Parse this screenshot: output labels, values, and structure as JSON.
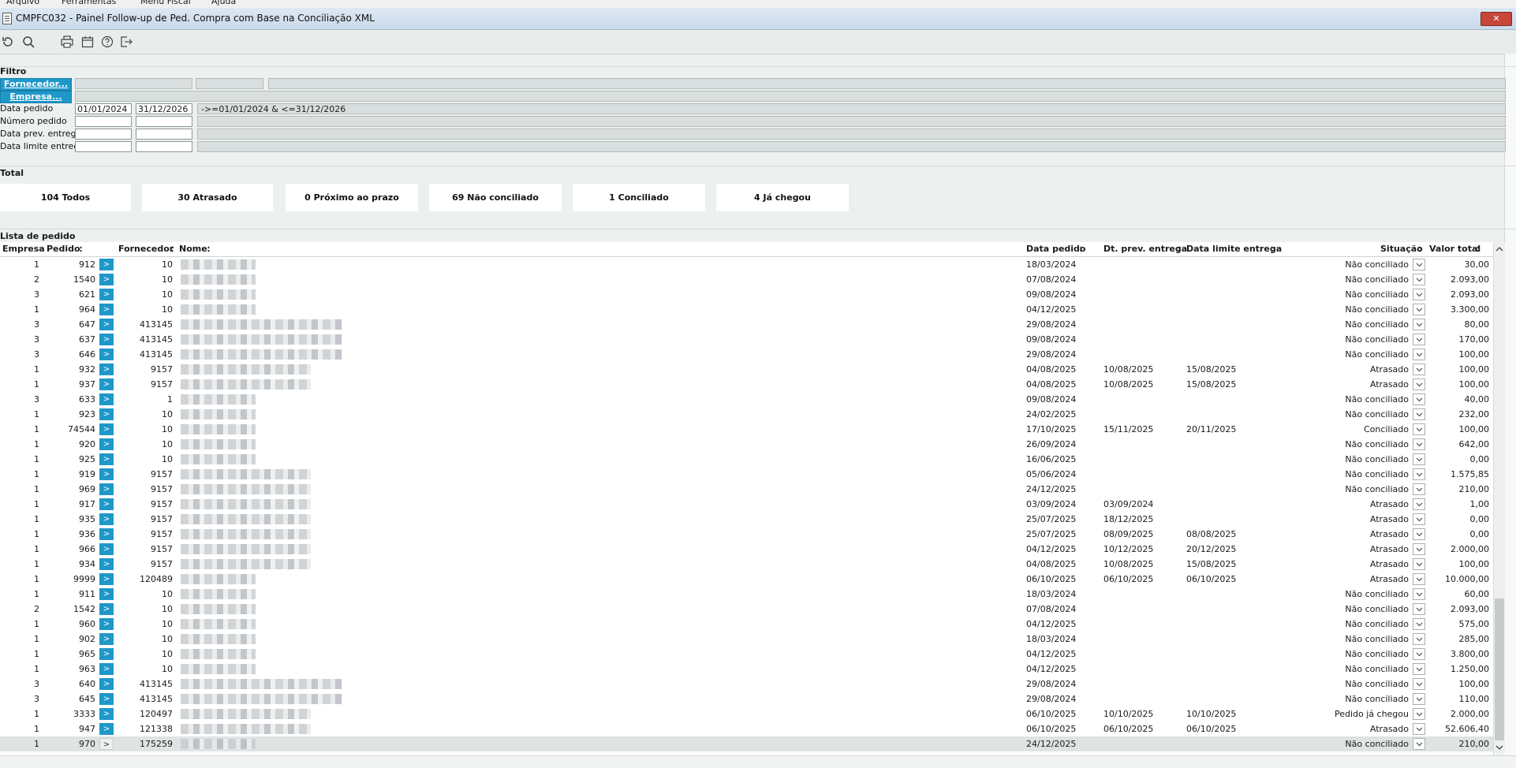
{
  "menu": [
    "Arquivo",
    "Ferramentas",
    "Menu Fiscal",
    "Ajuda"
  ],
  "window": {
    "title": "CMPFC032 - Painel Follow-up de Ped. Compra com Base na Conciliação XML",
    "close_label": "✕"
  },
  "toolbar": {
    "icons": [
      "refresh-icon",
      "search-icon",
      "print-icon",
      "calendar-icon",
      "help-icon",
      "exit-icon"
    ]
  },
  "filter": {
    "title": "Filtro",
    "fornecedor_button": "Fornecedor...",
    "empresa_button": "Empresa...",
    "data_pedido_label": "Data pedido",
    "data_pedido_from": "01/01/2024",
    "data_pedido_to": "31/12/2026",
    "data_pedido_expr": "->=01/01/2024 & <=31/12/2026",
    "numero_pedido_label": "Número pedido",
    "data_prev_label": "Data prev. entrega",
    "data_limite_label": "Data limite entrega"
  },
  "totals": {
    "title": "Total",
    "boxes": [
      "104 Todos",
      "30 Atrasado",
      "0 Próximo ao prazo",
      "69 Não conciliado",
      "1 Conciliado",
      "4 Já chegou"
    ]
  },
  "list": {
    "title": "Lista de pedido",
    "columns": {
      "empresa": "Empresa",
      "pedido": "Pedido",
      "fornecedor": "Fornecedor",
      "nome": "Nome",
      "data_pedido": "Data pedido",
      "dt_prev": "Dt. prev. entrega",
      "data_limite": "Data limite entrega",
      "situacao": "Situação",
      "valor_total": "Valor total"
    },
    "go_label": ">",
    "rows": [
      [
        "1",
        "912",
        "10",
        "18/03/2024",
        "",
        "",
        "Não conciliado",
        "30,00"
      ],
      [
        "2",
        "1540",
        "10",
        "07/08/2024",
        "",
        "",
        "Não conciliado",
        "2.093,00"
      ],
      [
        "3",
        "621",
        "10",
        "09/08/2024",
        "",
        "",
        "Não conciliado",
        "2.093,00"
      ],
      [
        "1",
        "964",
        "10",
        "04/12/2025",
        "",
        "",
        "Não conciliado",
        "3.300,00"
      ],
      [
        "3",
        "647",
        "413145",
        "29/08/2024",
        "",
        "",
        "Não conciliado",
        "80,00"
      ],
      [
        "3",
        "637",
        "413145",
        "09/08/2024",
        "",
        "",
        "Não conciliado",
        "170,00"
      ],
      [
        "3",
        "646",
        "413145",
        "29/08/2024",
        "",
        "",
        "Não conciliado",
        "100,00"
      ],
      [
        "1",
        "932",
        "9157",
        "04/08/2025",
        "10/08/2025",
        "15/08/2025",
        "Atrasado",
        "100,00"
      ],
      [
        "1",
        "937",
        "9157",
        "04/08/2025",
        "10/08/2025",
        "15/08/2025",
        "Atrasado",
        "100,00"
      ],
      [
        "3",
        "633",
        "1",
        "09/08/2024",
        "",
        "",
        "Não conciliado",
        "40,00"
      ],
      [
        "1",
        "923",
        "10",
        "24/02/2025",
        "",
        "",
        "Não conciliado",
        "232,00"
      ],
      [
        "1",
        "74544",
        "10",
        "17/10/2025",
        "15/11/2025",
        "20/11/2025",
        "Conciliado",
        "100,00"
      ],
      [
        "1",
        "920",
        "10",
        "26/09/2024",
        "",
        "",
        "Não conciliado",
        "642,00"
      ],
      [
        "1",
        "925",
        "10",
        "16/06/2025",
        "",
        "",
        "Não conciliado",
        "0,00"
      ],
      [
        "1",
        "919",
        "9157",
        "05/06/2024",
        "",
        "",
        "Não conciliado",
        "1.575,85"
      ],
      [
        "1",
        "969",
        "9157",
        "24/12/2025",
        "",
        "",
        "Não conciliado",
        "210,00"
      ],
      [
        "1",
        "917",
        "9157",
        "03/09/2024",
        "03/09/2024",
        "",
        "Atrasado",
        "1,00"
      ],
      [
        "1",
        "935",
        "9157",
        "25/07/2025",
        "18/12/2025",
        "",
        "Atrasado",
        "0,00"
      ],
      [
        "1",
        "936",
        "9157",
        "25/07/2025",
        "08/09/2025",
        "08/08/2025",
        "Atrasado",
        "0,00"
      ],
      [
        "1",
        "966",
        "9157",
        "04/12/2025",
        "10/12/2025",
        "20/12/2025",
        "Atrasado",
        "2.000,00"
      ],
      [
        "1",
        "934",
        "9157",
        "04/08/2025",
        "10/08/2025",
        "15/08/2025",
        "Atrasado",
        "100,00"
      ],
      [
        "1",
        "9999",
        "120489",
        "06/10/2025",
        "06/10/2025",
        "06/10/2025",
        "Atrasado",
        "10.000,00"
      ],
      [
        "1",
        "911",
        "10",
        "18/03/2024",
        "",
        "",
        "Não conciliado",
        "60,00"
      ],
      [
        "2",
        "1542",
        "10",
        "07/08/2024",
        "",
        "",
        "Não conciliado",
        "2.093,00"
      ],
      [
        "1",
        "960",
        "10",
        "04/12/2025",
        "",
        "",
        "Não conciliado",
        "575,00"
      ],
      [
        "1",
        "902",
        "10",
        "18/03/2024",
        "",
        "",
        "Não conciliado",
        "285,00"
      ],
      [
        "1",
        "965",
        "10",
        "04/12/2025",
        "",
        "",
        "Não conciliado",
        "3.800,00"
      ],
      [
        "1",
        "963",
        "10",
        "04/12/2025",
        "",
        "",
        "Não conciliado",
        "1.250,00"
      ],
      [
        "3",
        "640",
        "413145",
        "29/08/2024",
        "",
        "",
        "Não conciliado",
        "100,00"
      ],
      [
        "3",
        "645",
        "413145",
        "29/08/2024",
        "",
        "",
        "Não conciliado",
        "110,00"
      ],
      [
        "1",
        "3333",
        "120497",
        "06/10/2025",
        "10/10/2025",
        "10/10/2025",
        "Pedido já chegou",
        "2.000,00"
      ],
      [
        "1",
        "947",
        "121338",
        "06/10/2025",
        "06/10/2025",
        "06/10/2025",
        "Atrasado",
        "52.606,40"
      ],
      [
        "1",
        "970",
        "175259",
        "24/12/2025",
        "",
        "",
        "Não conciliado",
        "210,00"
      ]
    ]
  },
  "colors": {
    "accent": "#1e98c9",
    "background": "#ecf0ef",
    "close": "#c8453a"
  }
}
